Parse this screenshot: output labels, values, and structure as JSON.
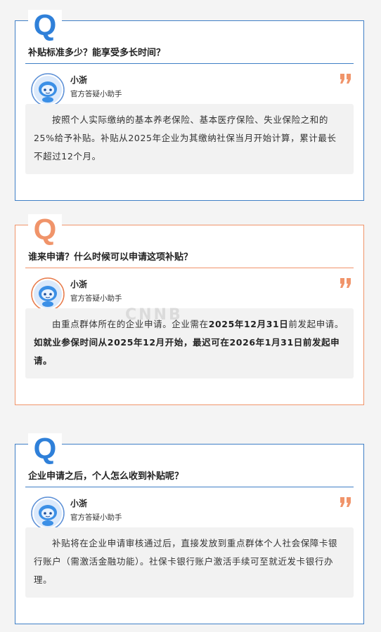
{
  "colors": {
    "blue": "#3f7fc6",
    "orange": "#f0946a",
    "badge_blue": "#2f80d9"
  },
  "qa": [
    {
      "badge": "Q",
      "question": "补贴标准多少？能享受多长时间？",
      "name": "小浙",
      "role": "官方答疑小助手",
      "answer": "按照个人实际缴纳的基本养老保险、基本医疗保险、失业保险之和的25%给予补贴。补贴从2025年企业为其缴纳社保当月开始计算，累计最长不超过12个月。"
    },
    {
      "badge": "Q",
      "question": "谁来申请？什么时候可以申请这项补贴？",
      "name": "小浙",
      "role": "官方答疑小助手",
      "answer_a": "由重点群体所在的企业申请。企业需在",
      "answer_b": "2025年12月31日",
      "answer_c": "前发起申请。",
      "answer_d": "如就业参保时间从2025年12月开始，最迟可在2026年1月31日前发起申请。"
    },
    {
      "badge": "Q",
      "question": "企业申请之后，个人怎么收到补贴呢？",
      "name": "小浙",
      "role": "官方答疑小助手",
      "answer": "补贴将在企业申请审核通过后，直接发放到重点群体个人社会保障卡银行账户（需激活金融功能）。社保卡银行账户激活手续可至就近发卡银行办理。"
    }
  ],
  "watermark": "CNNB"
}
